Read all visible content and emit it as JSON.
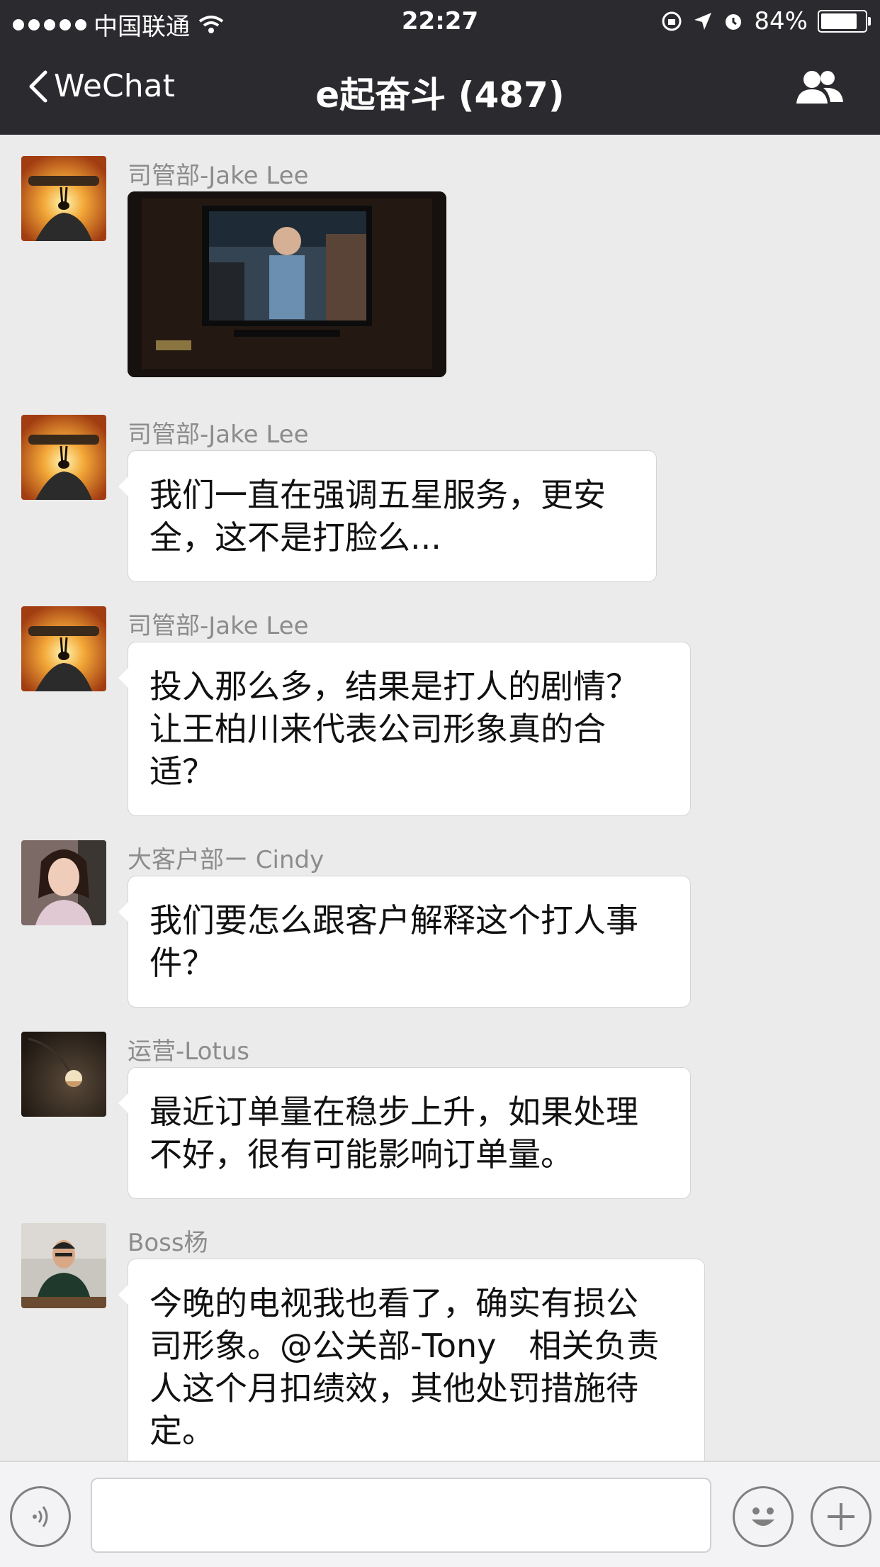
{
  "status_bar": {
    "carrier": "中国联通",
    "time": "22:27",
    "battery": "84%",
    "battery_level": 0.84
  },
  "nav": {
    "back_label": "WeChat",
    "title": "e起奋斗 (487)"
  },
  "messages": [
    {
      "sender": "司管部-Jake Lee",
      "type": "image",
      "image_desc": "tv-screen-photo"
    },
    {
      "sender": "司管部-Jake Lee",
      "type": "text",
      "lines": [
        "我们一直在强调五星服务，更安",
        "全，这不是打脸么..."
      ]
    },
    {
      "sender": "司管部-Jake Lee",
      "type": "text",
      "lines": [
        "投入那么多，结果是打人的剧情？",
        "让王柏川来代表公司形象真的合",
        "适？"
      ]
    },
    {
      "sender": "大客户部ー Cindy",
      "type": "text",
      "lines": [
        "我们要怎么跟客户解释这个打人事",
        "件？"
      ]
    },
    {
      "sender": "运营-Lotus",
      "type": "text",
      "lines": [
        "最近订单量在稳步上升，如果处理",
        "不好，很有可能影响订单量。"
      ]
    },
    {
      "sender": "Boss杨",
      "type": "text",
      "lines": [
        "今晚的电视我也看了，确实有损公",
        "司形象。@公关部-Tony　相关负责",
        "人这个月扣绩效，其他处罚措施待",
        "定。"
      ]
    }
  ],
  "input": {
    "placeholder": ""
  },
  "icons": {
    "back": "chevron-left-icon",
    "group": "group-members-icon",
    "voice": "voice-icon",
    "emoji": "emoji-icon",
    "plus": "plus-icon"
  },
  "colors": {
    "header_bg": "#2b2a2f",
    "chat_bg": "#ebebeb",
    "bubble_bg": "#ffffff"
  }
}
